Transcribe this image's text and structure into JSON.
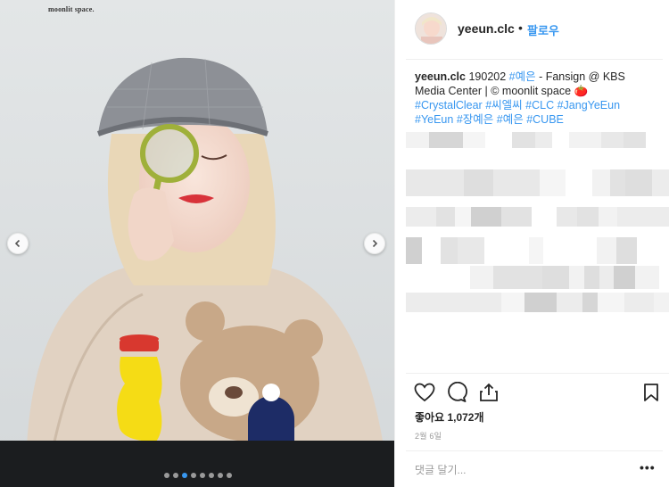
{
  "photo": {
    "watermark": "moonlit space.",
    "carousel": {
      "total_slides": 8,
      "active_index": 2
    }
  },
  "header": {
    "username": "yeeun.clc",
    "separator": "•",
    "follow_label": "팔로우"
  },
  "caption": {
    "username": "yeeun.clc",
    "text_1": " 190202 ",
    "tag_1": "#예은",
    "text_2": " - Fansign @ KBS Media Center | © moonlit space ",
    "emoji": "🍅",
    "hashtags": [
      "#CrystalClear",
      "#씨엘씨",
      "#CLC",
      "#JangYeEun",
      "#YeEun",
      "#장예은",
      "#예은",
      "#CUBE"
    ]
  },
  "actions": {
    "likes_text": "좋아요 1,072개",
    "date_text": "2월 6일"
  },
  "comment": {
    "placeholder": "댓글 달기...",
    "more_label": "•••"
  },
  "colors": {
    "accent": "#3897f0",
    "hashtag": "#003569",
    "border": "#efefef",
    "text": "#262626",
    "muted": "#999999"
  },
  "icons": {
    "like": "heart-icon",
    "comment": "comment-icon",
    "share": "share-icon",
    "save": "bookmark-icon",
    "prev": "chevron-left-icon",
    "next": "chevron-right-icon"
  }
}
